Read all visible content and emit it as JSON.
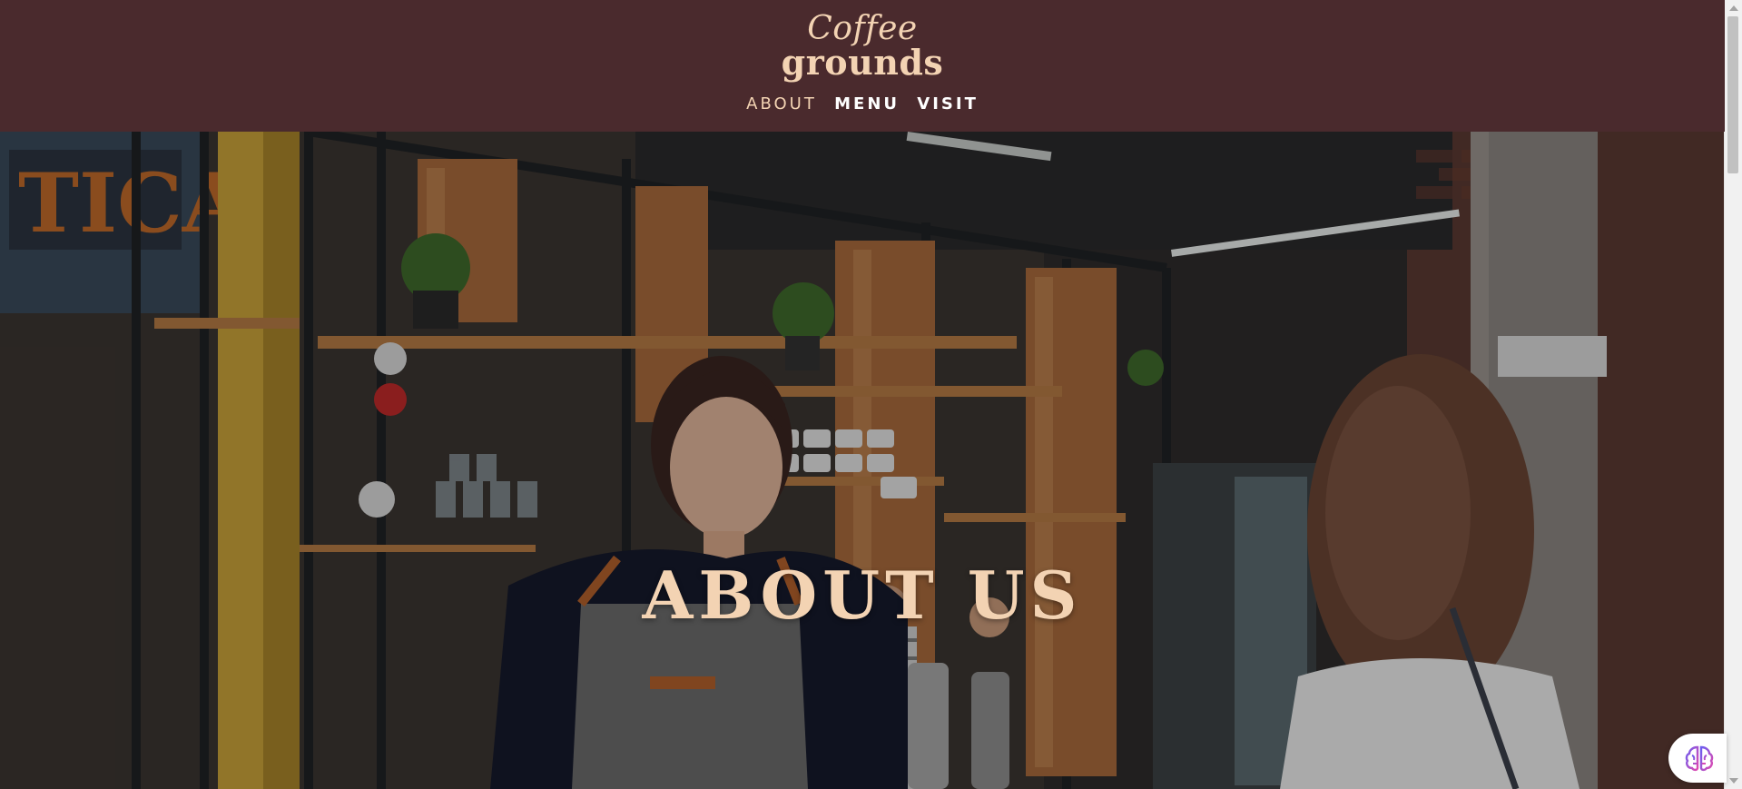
{
  "brand": {
    "line1": "Coffee",
    "line2": "grounds",
    "color": "#f3d3b3"
  },
  "nav": {
    "items": [
      {
        "label": "ABOUT",
        "active": true
      },
      {
        "label": "MENU",
        "active": false
      },
      {
        "label": "VISIT",
        "active": false
      }
    ]
  },
  "hero": {
    "title": "ABOUT US"
  },
  "floating_widget": {
    "icon": "brain-icon"
  },
  "colors": {
    "header_bg": "#4a2a2d",
    "accent": "#f3d3b3",
    "nav_text": "#ffffff"
  }
}
